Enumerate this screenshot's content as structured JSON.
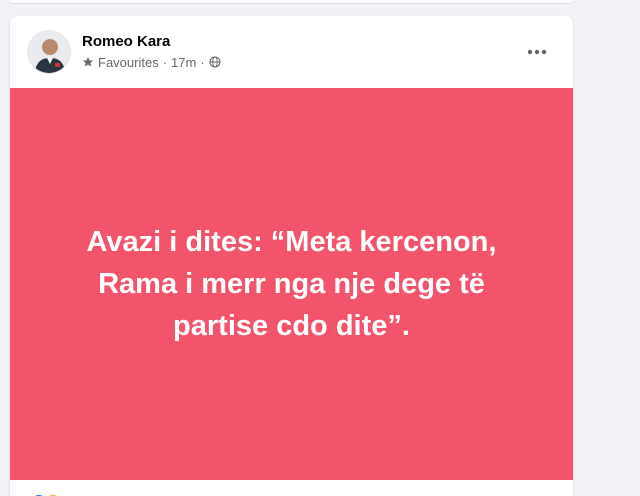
{
  "post": {
    "author": "Romeo Kara",
    "audience_label": "Favourites",
    "separator": "·",
    "timestamp": "17m",
    "privacy_icon": "globe-icon",
    "more_icon": "more-options-icon",
    "text": "Avazi i dites: “Meta kercenon, Rama i merr nga nje dege të partise cdo dite”.",
    "background_color": "#f2546b",
    "reactions": [
      "like",
      "haha"
    ]
  }
}
